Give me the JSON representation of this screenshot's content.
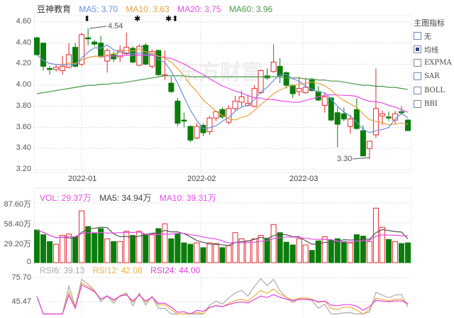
{
  "header": {
    "name": "豆神教育",
    "ma5": "MA5: 3.70",
    "ma10": "MA10: 3.63",
    "ma20": "MA20: 3.75",
    "ma60": "MA60: 3.96"
  },
  "colors": {
    "up": "#e8262c",
    "down": "#0a7d0a",
    "ma5": "#6a8fe0",
    "ma10": "#e8a33a",
    "ma20": "#e84ce8",
    "ma60": "#4a9a4a",
    "rsi6": "#aaaaaa",
    "rsi12": "#f0b040",
    "rsi24": "#e040e0"
  },
  "price_axis": [
    "4.60",
    "4.40",
    "4.20",
    "4.00",
    "3.80",
    "3.60",
    "3.40",
    "3.20"
  ],
  "x_axis": [
    "2022-01",
    "2022-02",
    "2022-03"
  ],
  "annotations": {
    "high": "4.54",
    "low": "3.30"
  },
  "side_panel": {
    "title": "主图指标",
    "items": [
      {
        "label": "无",
        "checked": false
      },
      {
        "label": "均线",
        "checked": true
      },
      {
        "label": "EXPMA",
        "checked": false
      },
      {
        "label": "SAR",
        "checked": false
      },
      {
        "label": "BOLL",
        "checked": false
      },
      {
        "label": "BBI",
        "checked": false
      }
    ]
  },
  "volume": {
    "vol": "VOL: 29.37万",
    "ma5": "MA5: 34.94万",
    "ma10": "MA10: 39.31万",
    "axis": [
      "87.60万",
      "58.40万",
      "29.20万",
      "0"
    ]
  },
  "rsi": {
    "rsi6": "RSI6: 39.13",
    "rsi12": "RSI12: 42.08",
    "rsi24": "RSI24: 44.00",
    "axis": [
      "75.70",
      "45.47"
    ]
  },
  "chart_data": {
    "type": "candlestick",
    "ylim": [
      3.2,
      4.6
    ],
    "ohlc": [
      [
        4.45,
        4.46,
        4.28,
        4.29
      ],
      [
        4.4,
        4.4,
        4.14,
        4.18
      ],
      [
        4.16,
        4.18,
        4.1,
        4.15
      ],
      [
        4.15,
        4.2,
        4.13,
        4.17
      ],
      [
        4.14,
        4.28,
        4.1,
        4.18
      ],
      [
        4.17,
        4.4,
        4.16,
        4.29
      ],
      [
        4.36,
        4.4,
        4.17,
        4.18
      ],
      [
        4.2,
        4.5,
        4.18,
        4.48
      ],
      [
        4.45,
        4.54,
        4.38,
        4.44
      ],
      [
        4.41,
        4.43,
        4.37,
        4.39
      ],
      [
        4.4,
        4.47,
        4.26,
        4.27
      ],
      [
        4.23,
        4.35,
        4.12,
        4.33
      ],
      [
        4.29,
        4.32,
        4.22,
        4.25
      ],
      [
        4.27,
        4.38,
        4.22,
        4.33
      ],
      [
        4.3,
        4.5,
        4.29,
        4.36
      ],
      [
        4.35,
        4.37,
        4.21,
        4.22
      ],
      [
        4.19,
        4.39,
        4.18,
        4.37
      ],
      [
        4.38,
        4.4,
        4.19,
        4.2
      ],
      [
        4.18,
        4.34,
        4.16,
        4.32
      ],
      [
        4.33,
        4.34,
        4.09,
        4.1
      ],
      [
        4.09,
        4.33,
        4.05,
        4.1
      ],
      [
        4.02,
        4.08,
        3.93,
        3.94
      ],
      [
        3.85,
        3.88,
        3.61,
        3.64
      ],
      [
        3.67,
        3.74,
        3.6,
        3.66
      ],
      [
        3.61,
        3.62,
        3.46,
        3.48
      ],
      [
        3.5,
        3.64,
        3.49,
        3.61
      ],
      [
        3.62,
        3.64,
        3.52,
        3.55
      ],
      [
        3.56,
        3.71,
        3.53,
        3.69
      ],
      [
        3.69,
        3.76,
        3.66,
        3.75
      ],
      [
        3.77,
        3.79,
        3.68,
        3.7
      ],
      [
        3.65,
        3.81,
        3.63,
        3.78
      ],
      [
        3.78,
        3.9,
        3.76,
        3.85
      ],
      [
        3.84,
        3.95,
        3.79,
        3.89
      ],
      [
        3.81,
        3.91,
        3.8,
        3.83
      ],
      [
        3.8,
        4.0,
        3.79,
        3.97
      ],
      [
        3.93,
        4.15,
        3.92,
        4.14
      ],
      [
        4.09,
        4.16,
        4.05,
        4.07
      ],
      [
        4.13,
        4.39,
        4.12,
        4.22
      ],
      [
        4.18,
        4.26,
        4.02,
        4.09
      ],
      [
        4.12,
        4.13,
        3.97,
        4.0
      ],
      [
        4.0,
        4.01,
        3.88,
        3.92
      ],
      [
        3.94,
        4.08,
        3.9,
        3.97
      ],
      [
        3.93,
        4.07,
        3.92,
        3.98
      ],
      [
        4.05,
        4.07,
        3.94,
        3.95
      ],
      [
        3.94,
        3.99,
        3.85,
        3.86
      ],
      [
        3.81,
        3.93,
        3.74,
        3.89
      ],
      [
        3.88,
        3.89,
        3.66,
        3.67
      ],
      [
        3.74,
        3.79,
        3.41,
        3.63
      ],
      [
        3.73,
        3.79,
        3.66,
        3.68
      ],
      [
        3.61,
        3.72,
        3.54,
        3.68
      ],
      [
        3.77,
        3.88,
        3.58,
        3.59
      ],
      [
        3.57,
        3.62,
        3.33,
        3.33
      ],
      [
        3.4,
        3.47,
        3.3,
        3.47
      ],
      [
        3.53,
        4.16,
        3.5,
        3.78
      ],
      [
        3.71,
        3.76,
        3.62,
        3.73
      ],
      [
        3.7,
        3.75,
        3.66,
        3.69
      ],
      [
        3.67,
        3.76,
        3.63,
        3.73
      ],
      [
        3.75,
        3.8,
        3.72,
        3.74
      ],
      [
        3.67,
        3.68,
        3.57,
        3.57
      ]
    ],
    "volume": [
      48,
      41,
      31,
      27,
      40,
      42,
      38,
      76,
      53,
      43,
      50,
      35,
      31,
      31,
      46,
      40,
      46,
      42,
      42,
      50,
      57,
      35,
      42,
      29,
      27,
      29,
      22,
      29,
      28,
      22,
      25,
      44,
      35,
      32,
      35,
      40,
      35,
      56,
      44,
      30,
      26,
      35,
      26,
      18,
      32,
      38,
      33,
      35,
      31,
      29,
      41,
      39,
      31,
      80,
      52,
      34,
      31,
      28,
      29
    ],
    "ma60": [
      3.92,
      3.93,
      3.94,
      3.95,
      3.96,
      3.97,
      3.98,
      3.99,
      4.0,
      4.0,
      4.01,
      4.01,
      4.02,
      4.02,
      4.03,
      4.04,
      4.05,
      4.06,
      4.07,
      4.08,
      4.09,
      4.09,
      4.09,
      4.09,
      4.08,
      4.08,
      4.08,
      4.08,
      4.08,
      4.08,
      4.08,
      4.08,
      4.08,
      4.08,
      4.08,
      4.08,
      4.08,
      4.08,
      4.08,
      4.07,
      4.07,
      4.07,
      4.06,
      4.06,
      4.05,
      4.05,
      4.04,
      4.04,
      4.03,
      4.02,
      4.01,
      4.0,
      4.0,
      3.99,
      3.99,
      3.98,
      3.98,
      3.97,
      3.96
    ]
  }
}
